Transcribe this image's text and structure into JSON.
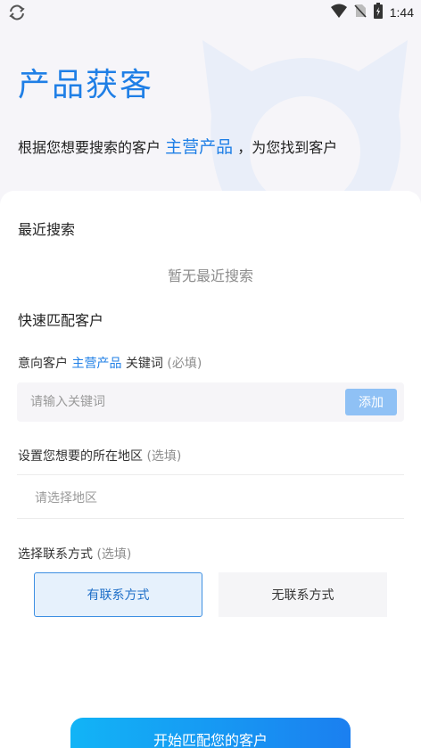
{
  "status_bar": {
    "time": "1:44",
    "icons": [
      "sync-icon",
      "wifi-icon",
      "no-sim-icon",
      "battery-charging-icon"
    ]
  },
  "hero": {
    "title": "产品获客",
    "subtitle_before": "根据您想要搜索的客户",
    "subtitle_highlight": "主营产品",
    "subtitle_after": "，为您找到客户"
  },
  "recent": {
    "title": "最近搜索",
    "empty_text": "暂无最近搜索"
  },
  "quick_match": {
    "title": "快速匹配客户",
    "keyword_label_before": "意向客户",
    "keyword_label_highlight": "主营产品",
    "keyword_label_after": "关键词",
    "keyword_label_note": "(必填)",
    "keyword_placeholder": "请输入关键词",
    "add_label": "添加",
    "region_label": "设置您想要的所在地区",
    "region_note": "(选填)",
    "region_placeholder": "请选择地区",
    "contact_label": "选择联系方式",
    "contact_note": "(选填)",
    "contact_options": [
      "有联系方式",
      "无联系方式"
    ],
    "contact_selected": "有联系方式"
  },
  "start_button": "开始匹配您的客户",
  "colors": {
    "accent": "#1f7fe6",
    "add_button": "#8fc1f5",
    "selected_option_bg": "#e6f1fc",
    "start_gradient_from": "#12b4f6",
    "start_gradient_to": "#1b7ff0"
  }
}
